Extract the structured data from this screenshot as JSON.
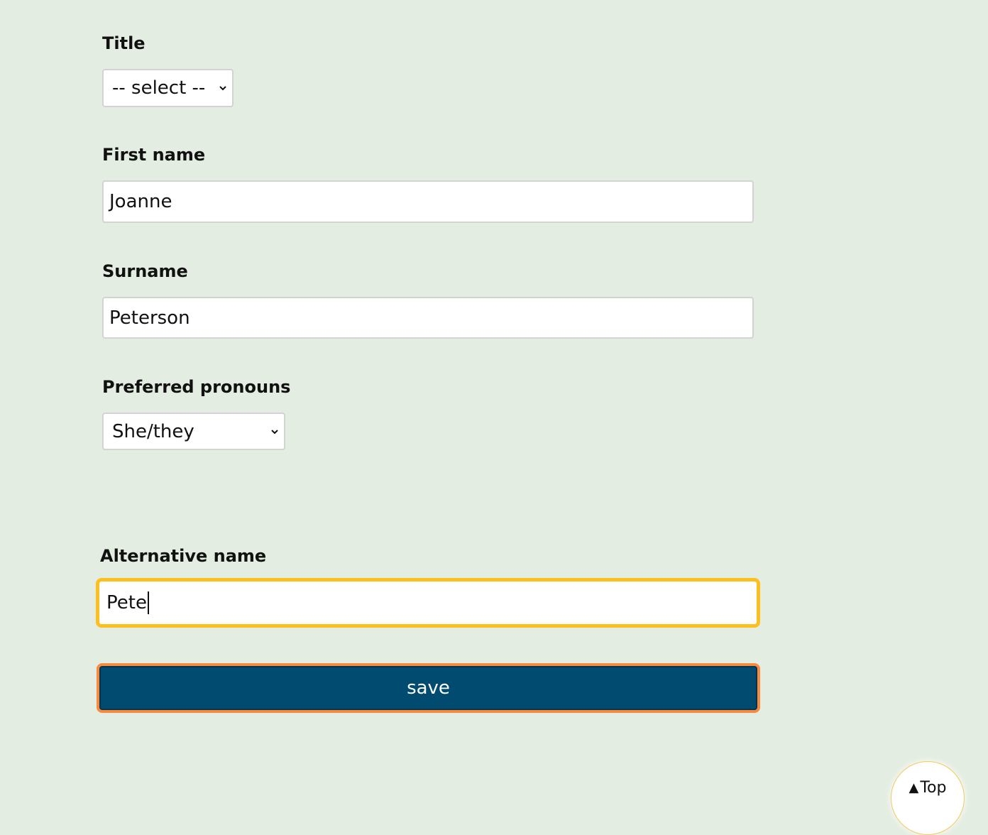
{
  "form": {
    "title_label": "Title",
    "title_select": {
      "selected": "-- select --"
    },
    "first_name_label": "First name",
    "first_name_value": "Joanne",
    "surname_label": "Surname",
    "surname_value": "Peterson",
    "pronouns_label": "Preferred pronouns",
    "pronouns_select": {
      "selected": "She/they"
    },
    "alt_name_label": "Alternative name",
    "alt_name_value": "Pete",
    "save_label": "save"
  },
  "back_to_top": {
    "icon": "triangle-up-icon",
    "glyph": "▲",
    "label": "Top"
  },
  "colors": {
    "background": "#e4ede2",
    "focus_ring": "#fcbf1e",
    "button_bg": "#004b6f",
    "button_outline": "#f78a3e"
  }
}
